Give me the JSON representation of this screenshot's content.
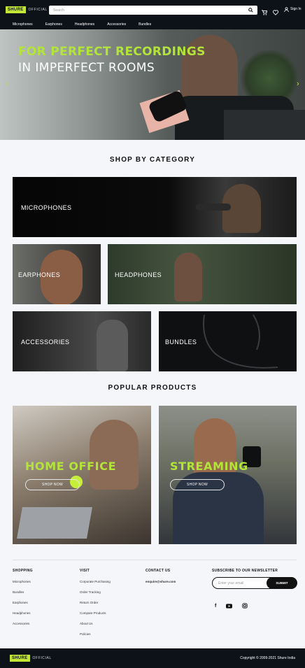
{
  "header": {
    "logo_text": "SHURE",
    "logo_sub": "OFFICIAL",
    "search_placeholder": "Search",
    "signin_label": "Sign In",
    "icons": [
      "search-icon",
      "cart-icon",
      "heart-icon",
      "user-icon"
    ]
  },
  "nav": {
    "items": [
      "Microphones",
      "Earphones",
      "Headphones",
      "Accessories",
      "Bundles"
    ]
  },
  "hero": {
    "line1": "FOR PERFECT RECORDINGS",
    "line2": "IN IMPERFECT ROOMS",
    "prev": "‹",
    "next": "›",
    "slides": 4,
    "accent": "#b3e43a"
  },
  "categories": {
    "title": "SHOP BY CATEGORY",
    "items": [
      "MICROPHONES",
      "EARPHONES",
      "HEADPHONES",
      "ACCESSORIES",
      "BUNDLES"
    ]
  },
  "popular": {
    "title": "POPULAR PRODUCTS",
    "items": [
      {
        "title": "HOME OFFICE",
        "button": "SHOP NOW"
      },
      {
        "title": "STREAMING",
        "button": "SHOP NOW"
      }
    ]
  },
  "footer": {
    "shopping": {
      "heading": "SHOPPING",
      "links": [
        "Microphones",
        "Bundles",
        "Earphones",
        "Headphones",
        "Accessories"
      ]
    },
    "visit": {
      "heading": "VISIT",
      "links": [
        "Corporate Purchasing",
        "Order Tracking",
        "Return Order",
        "Compare Products",
        "About Us",
        "Policies"
      ]
    },
    "contact": {
      "heading": "CONTACT US",
      "email": "enquire@shure.com"
    },
    "newsletter": {
      "heading": "SUBSCRIBE TO OUR NEWSLETTER",
      "placeholder": "Enter your email",
      "button": "SUBMIT"
    },
    "social_icons": [
      "facebook-icon",
      "youtube-icon",
      "instagram-icon"
    ],
    "facebook_glyph": "f"
  },
  "bottom": {
    "logo_text": "SHURE",
    "logo_sub": "OFFICIAL",
    "copyright": "Copyright © 2009-2021 Shure India"
  }
}
